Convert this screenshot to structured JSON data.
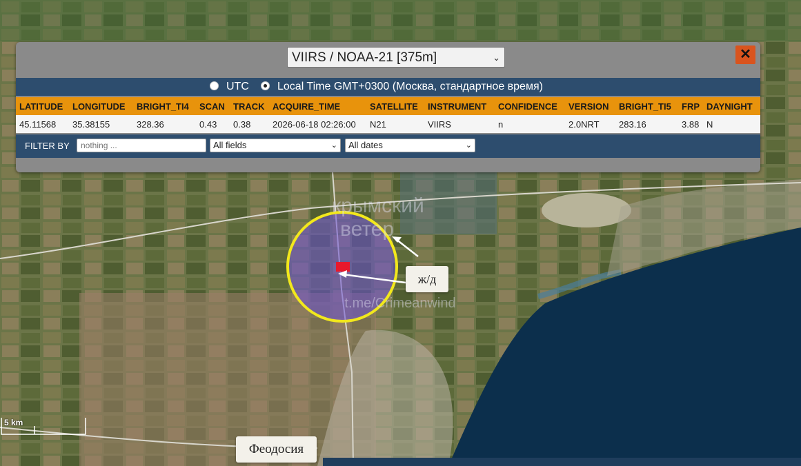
{
  "map": {
    "scale_label": "5 km",
    "city_label": "Феодосия",
    "annotation_label": "ж/д",
    "watermark_line1": "крымский",
    "watermark_line2": "ветер",
    "watermark_url": "t.me/Crimeanwind",
    "fire_marker_color": "#e8192c",
    "circle_color": "#f2e81c",
    "sea_color": "#0c2f4c"
  },
  "panel": {
    "satellite_selected": "VIIRS / NOAA-21 [375m]",
    "close_icon": "✕",
    "time_options": [
      {
        "label": "UTC",
        "selected": false
      },
      {
        "label": "Local Time GMT+0300 (Москва, стандартное время)",
        "selected": true
      }
    ],
    "columns": [
      "LATITUDE",
      "LONGITUDE",
      "BRIGHT_TI4",
      "SCAN",
      "TRACK",
      "ACQUIRE_TIME",
      "SATELLITE",
      "INSTRUMENT",
      "CONFIDENCE",
      "VERSION",
      "BRIGHT_TI5",
      "FRP",
      "DAYNIGHT"
    ],
    "row": [
      "45.11568",
      "35.38155",
      "328.36",
      "0.43",
      "0.38",
      "2026-06-18 02:26:00",
      "N21",
      "VIIRS",
      "n",
      "2.0NRT",
      "283.16",
      "3.88",
      "N"
    ],
    "filter": {
      "label": "FILTER BY",
      "placeholder": "nothing ...",
      "fields_selected": "All fields",
      "dates_selected": "All dates"
    },
    "header_color": "#e8930c",
    "bar_color": "#2d4d6e"
  }
}
